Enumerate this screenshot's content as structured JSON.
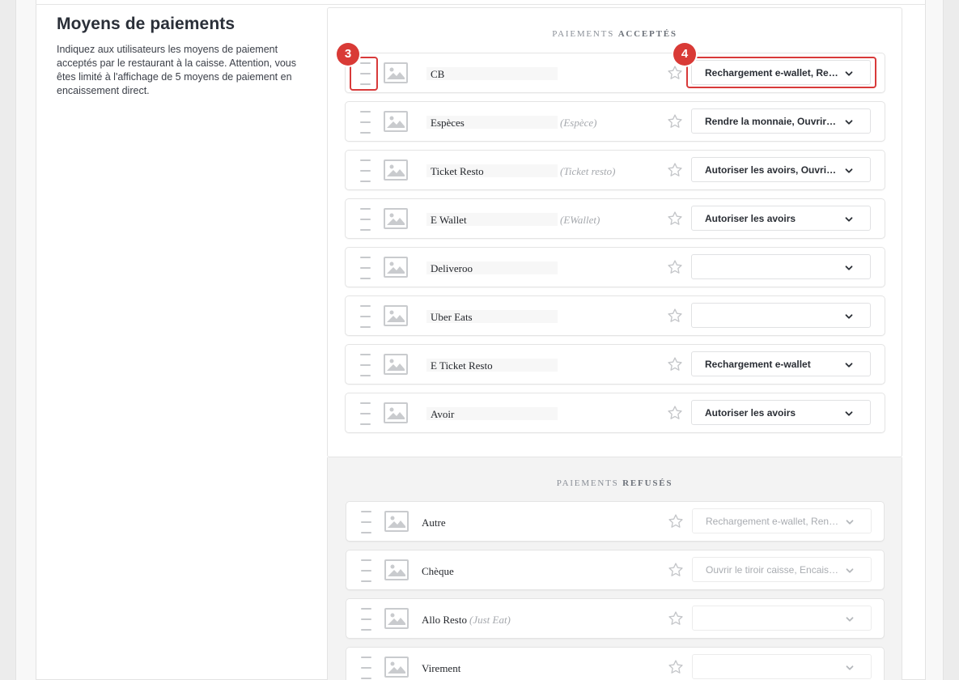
{
  "section": {
    "title": "Moyens de paiements",
    "description": "Indiquez aux utilisateurs les moyens de paiement acceptés par le restaurant à la caisse. Attention, vous êtes limité à l'affichage de 5 moyens de paiement en encaissement direct."
  },
  "accepted": {
    "heading_prefix": "PAIEMENTS",
    "heading_emphasis": "ACCEPTÉS",
    "rows": [
      {
        "name": "CB",
        "alias": "",
        "option": "Rechargement e-wallet, Rendre la monnaie"
      },
      {
        "name": "Espèces",
        "alias": "(Espèce)",
        "option": "Rendre la monnaie, Ouvrir le tiroir caisse"
      },
      {
        "name": "Ticket Resto",
        "alias": "(Ticket resto)",
        "option": "Autoriser les avoirs, Ouvrir le tiroir caisse"
      },
      {
        "name": "E Wallet",
        "alias": "(EWallet)",
        "option": "Autoriser les avoirs"
      },
      {
        "name": "Deliveroo",
        "alias": "",
        "option": ""
      },
      {
        "name": "Uber Eats",
        "alias": "",
        "option": ""
      },
      {
        "name": "E Ticket Resto",
        "alias": "",
        "option": "Rechargement e-wallet"
      },
      {
        "name": "Avoir",
        "alias": "",
        "option": "Autoriser les avoirs"
      }
    ]
  },
  "refused": {
    "heading_prefix": "PAIEMENTS",
    "heading_emphasis": "REFUSÉS",
    "rows": [
      {
        "name": "Autre",
        "alias": "",
        "option": "Rechargement e-wallet, Rendre la monnaie"
      },
      {
        "name": "Chèque",
        "alias": "",
        "option": "Ouvrir le tiroir caisse, Encaissement direct"
      },
      {
        "name": "Allo Resto",
        "alias": "(Just Eat)",
        "option": ""
      },
      {
        "name": "Virement",
        "alias": "",
        "option": ""
      }
    ]
  },
  "annotations": {
    "badge_3": "3",
    "badge_4": "4",
    "highlight_color": "#d83a3a"
  },
  "icons": {
    "drag": "drag-handle-icon",
    "image": "image-placeholder-icon",
    "favorite": "star-icon",
    "dropdown": "chevron-down-icon"
  }
}
